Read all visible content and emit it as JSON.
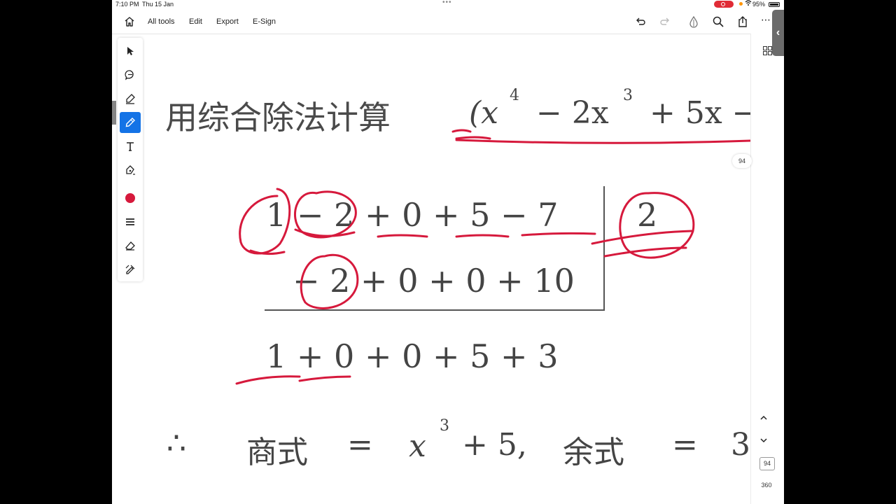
{
  "status_bar": {
    "time": "7:10 PM",
    "date": "Thu 15 Jan",
    "battery": "95%"
  },
  "toolbar": {
    "all_tools": "All tools",
    "edit": "Edit",
    "export": "Export",
    "esign": "E-Sign"
  },
  "palette": {
    "active_color": "#d6193c"
  },
  "document": {
    "title_zh": "用综合除法计算",
    "expr_x": "(x",
    "exp4": "4",
    "expr_2x": "− 2x",
    "exp3": "3",
    "expr_tail": "+ 5x −",
    "row1": "1 − 2 + 0 + 5 −  7",
    "divisor": "2",
    "row2": "− 2 + 0 + 0 + 10",
    "row3": "1 + 0 + 0 + 5 +  3",
    "therefore": "∴",
    "quotient_label": "商式",
    "eq1": "=",
    "x_var": "x",
    "exp3b": "3",
    "plus5": "+ 5,",
    "remainder_label": "余式",
    "eq2": "=",
    "remainder_value": "3"
  },
  "right_rail": {
    "page_badge_top": "94",
    "current_page": "94",
    "total_pages": "360"
  }
}
